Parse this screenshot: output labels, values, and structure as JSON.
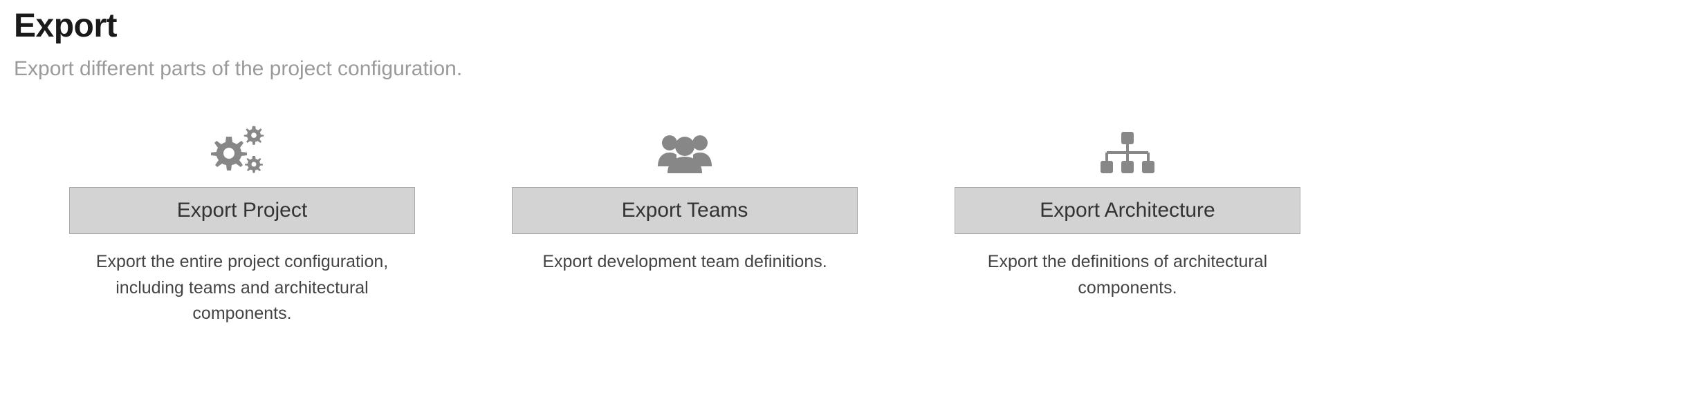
{
  "header": {
    "title": "Export",
    "subtitle": "Export different parts of the project configuration."
  },
  "cards": {
    "project": {
      "icon": "gears-icon",
      "button_label": "Export Project",
      "description": "Export the entire project configuration, including teams and architectural components."
    },
    "teams": {
      "icon": "users-icon",
      "button_label": "Export Teams",
      "description": "Export development team definitions."
    },
    "architecture": {
      "icon": "sitemap-icon",
      "button_label": "Export Architecture",
      "description": "Export the definitions of architectural components."
    }
  }
}
